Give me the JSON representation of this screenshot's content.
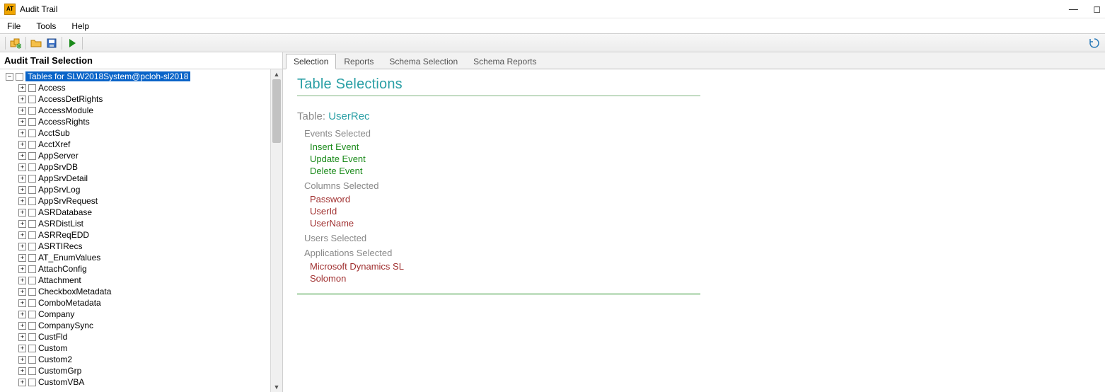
{
  "window": {
    "title": "Audit Trail"
  },
  "menu": {
    "file": "File",
    "tools": "Tools",
    "help": "Help"
  },
  "sidebar": {
    "title": "Audit Trail Selection",
    "rootLabel": "Tables for SLW2018System@pcloh-sl2018",
    "items": [
      "Access",
      "AccessDetRights",
      "AccessModule",
      "AccessRights",
      "AcctSub",
      "AcctXref",
      "AppServer",
      "AppSrvDB",
      "AppSrvDetail",
      "AppSrvLog",
      "AppSrvRequest",
      "ASRDatabase",
      "ASRDistList",
      "ASRReqEDD",
      "ASRTIRecs",
      "AT_EnumValues",
      "AttachConfig",
      "Attachment",
      "CheckboxMetadata",
      "ComboMetadata",
      "Company",
      "CompanySync",
      "CustFld",
      "Custom",
      "Custom2",
      "CustomGrp",
      "CustomVBA"
    ]
  },
  "tabs": {
    "selection": "Selection",
    "reports": "Reports",
    "schemaSel": "Schema Selection",
    "schemaRep": "Schema Reports"
  },
  "main": {
    "heading": "Table Selections",
    "tableLabel": "Table: ",
    "tableName": "UserRec",
    "eventsHead": "Events Selected",
    "events": [
      "Insert Event",
      "Update Event",
      "Delete Event"
    ],
    "columnsHead": "Columns Selected",
    "columns": [
      "Password",
      "UserId",
      "UserName"
    ],
    "usersHead": "Users Selected",
    "appsHead": "Applications Selected",
    "apps": [
      "Microsoft Dynamics SL",
      "Solomon"
    ]
  }
}
